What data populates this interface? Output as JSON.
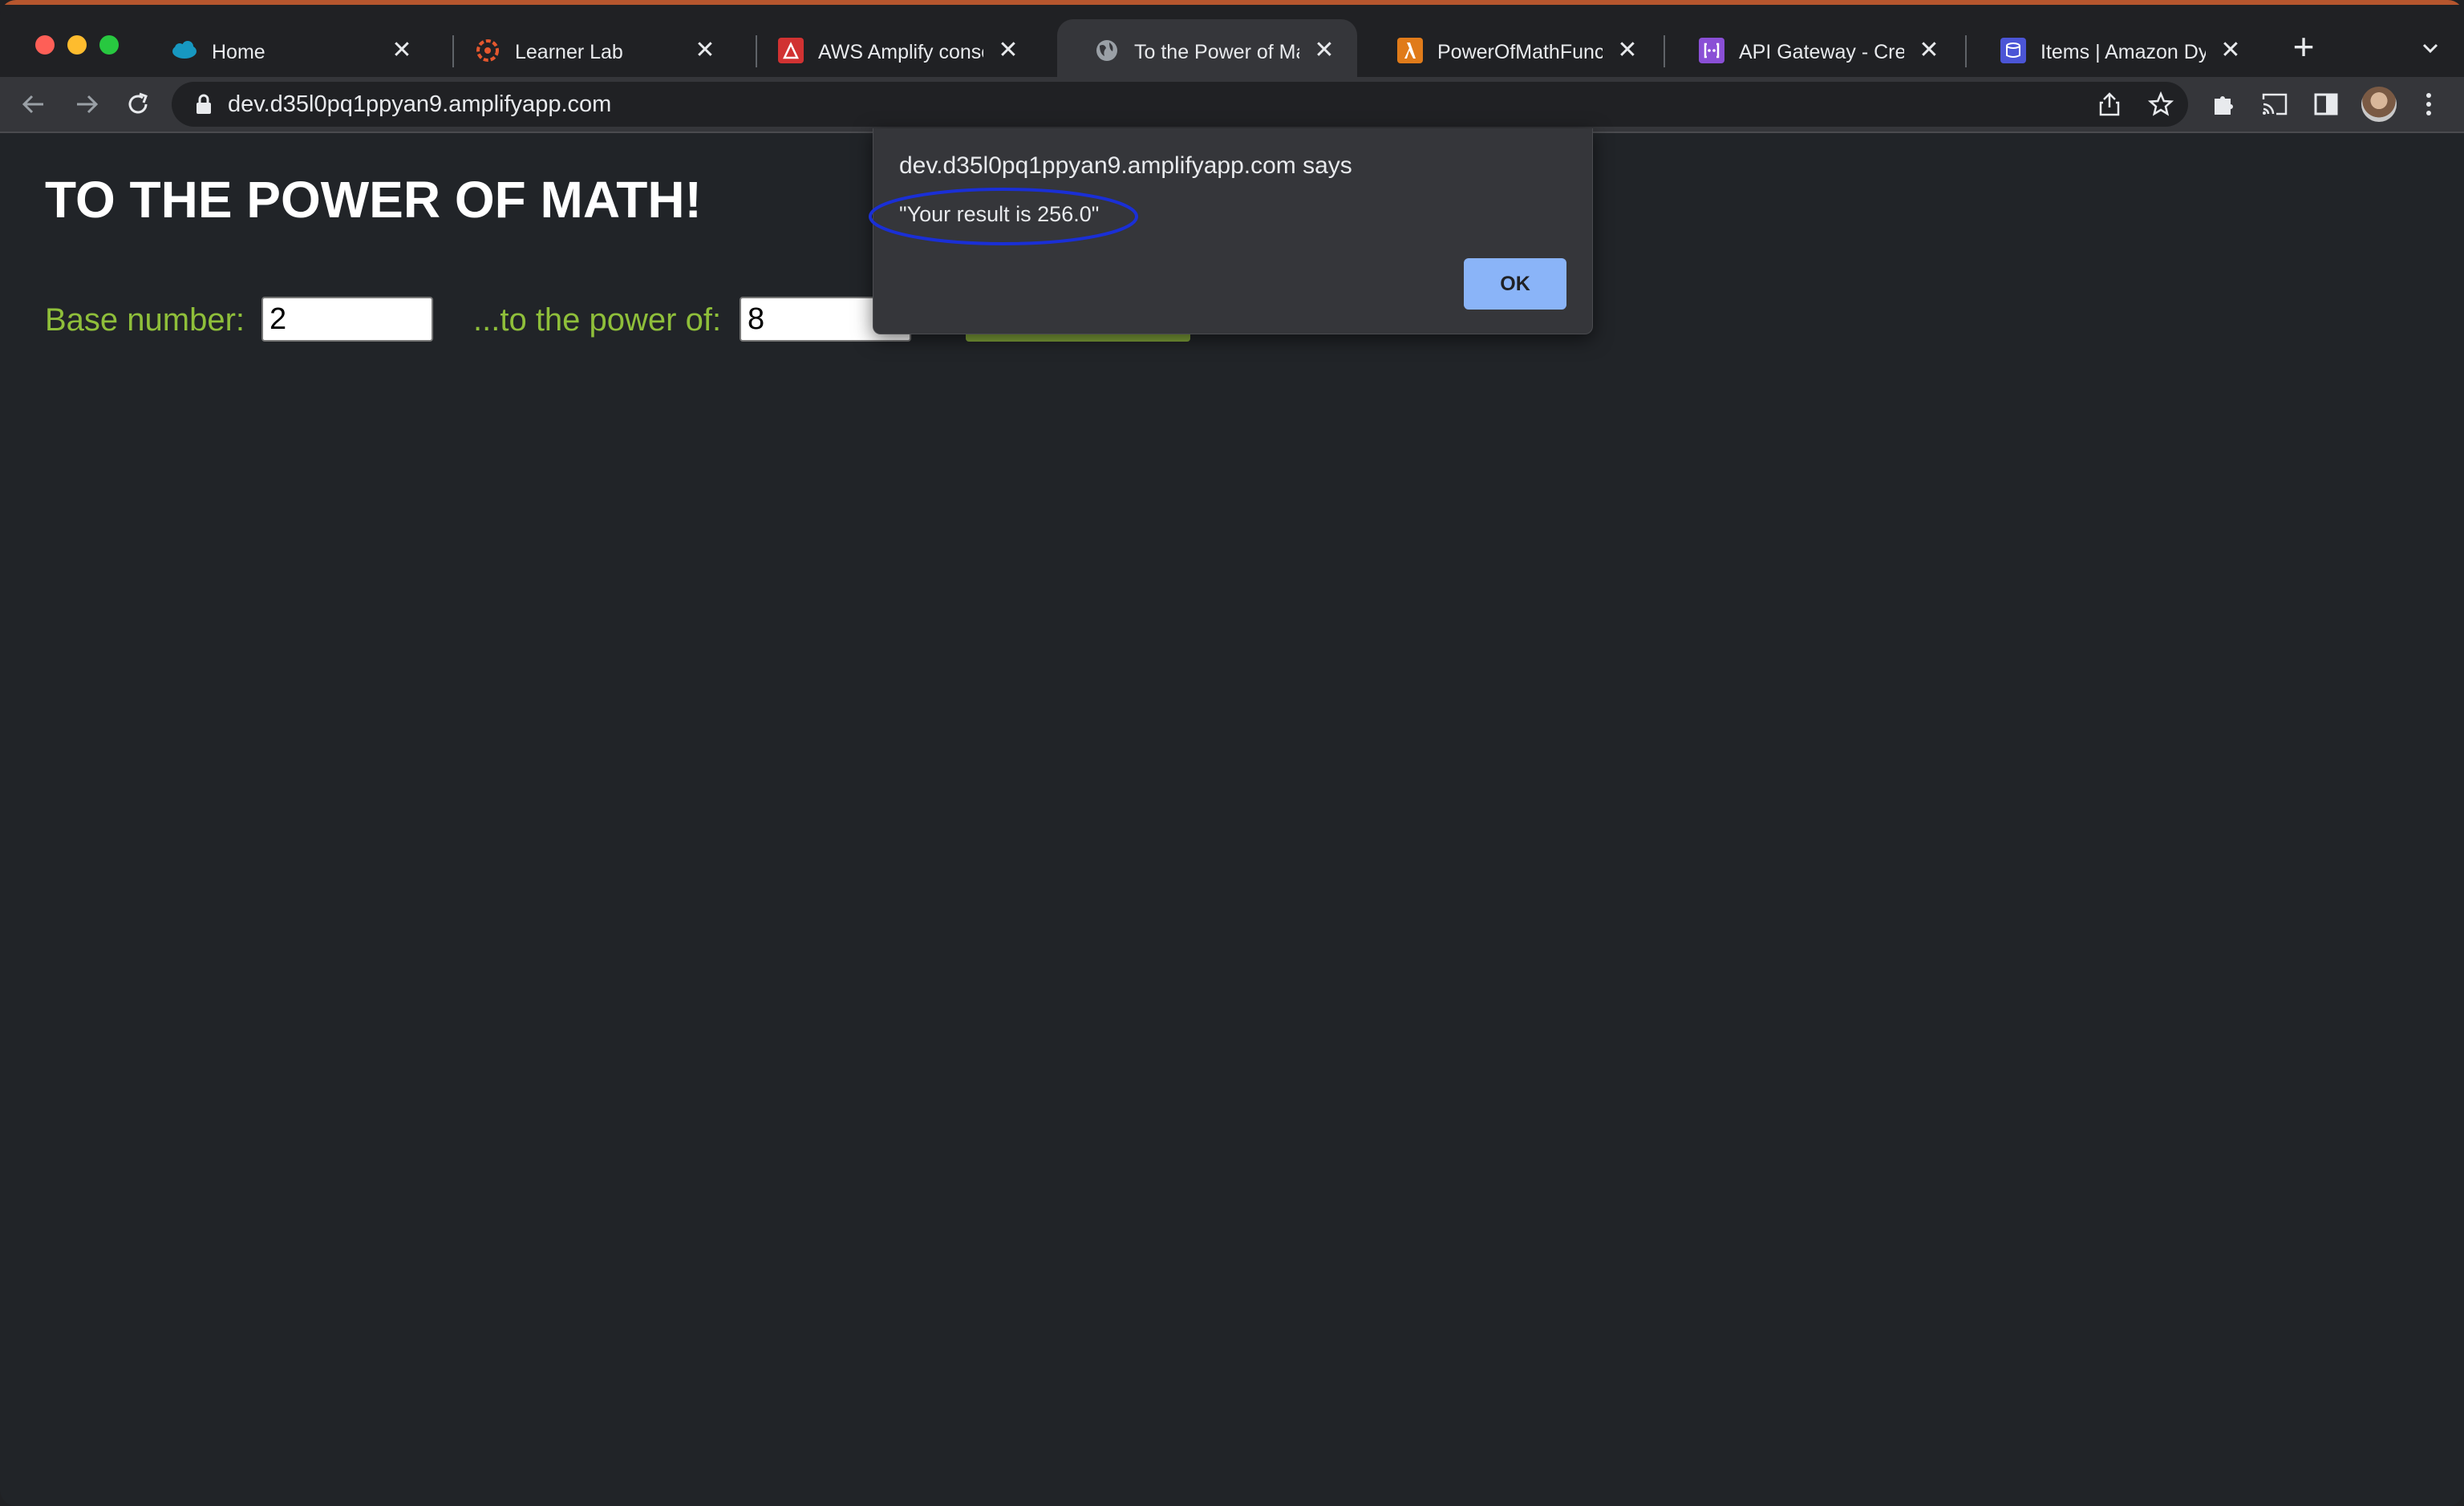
{
  "tabs": [
    {
      "title": "Home",
      "icon": "salesforce-cloud-icon",
      "active": false
    },
    {
      "title": "Learner Lab",
      "icon": "learner-lab-icon",
      "active": false
    },
    {
      "title": "AWS Amplify console",
      "icon": "aws-amplify-icon",
      "active": false
    },
    {
      "title": "To the Power of Math!",
      "icon": "globe-icon",
      "active": true
    },
    {
      "title": "PowerOfMathFunction",
      "icon": "aws-lambda-icon",
      "active": false
    },
    {
      "title": "API Gateway - Create",
      "icon": "api-gateway-icon",
      "active": false
    },
    {
      "title": "Items | Amazon Dynamo",
      "icon": "dynamodb-icon",
      "active": false
    }
  ],
  "toolbar": {
    "url": "dev.d35l0pq1ppyan9.amplifyapp.com"
  },
  "page": {
    "title": "TO THE POWER OF MATH!",
    "base_label": "Base number:",
    "base_value": "2",
    "exponent_label": "...to the power of:",
    "exponent_value": "8"
  },
  "dialog": {
    "title": "dev.d35l0pq1ppyan9.amplifyapp.com says",
    "message": "\"Your result is 256.0\"",
    "ok_label": "OK"
  },
  "colors": {
    "page_background": "#212428",
    "label_green": "#8fbf3a",
    "ok_button": "#8ab4f8",
    "annotation_ellipse": "#1a2fd6"
  }
}
